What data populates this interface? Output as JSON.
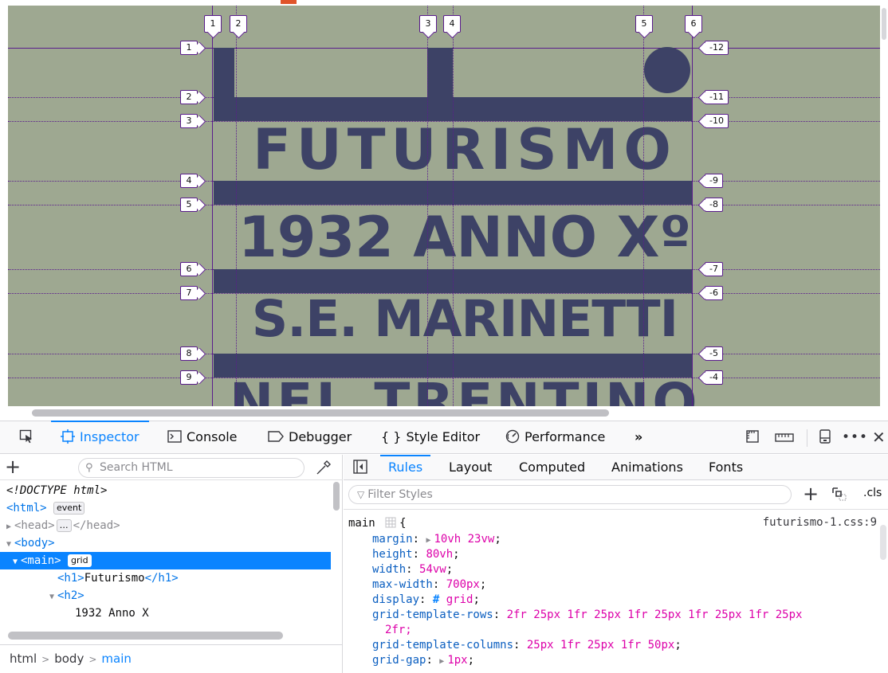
{
  "poster": {
    "lines": [
      "FUTURISMO",
      "1932 ANNO Xº",
      "S.E. MARINETTI",
      "NEL TRENTINO"
    ],
    "row_labels_left": [
      "1",
      "2",
      "3",
      "4",
      "5",
      "6",
      "7",
      "8",
      "9"
    ],
    "row_labels_right": [
      "-12",
      "-11",
      "-10",
      "-9",
      "-8",
      "-7",
      "-6",
      "-5",
      "-4"
    ],
    "col_labels_top": [
      "1",
      "2",
      "3",
      "4",
      "5",
      "6"
    ],
    "colors": {
      "background": "#9ea891",
      "ink": "#3d4266",
      "grid_overlay": "#5a1d8c"
    }
  },
  "devtools": {
    "tabs": [
      {
        "label": "Inspector",
        "icon": "inspector-icon"
      },
      {
        "label": "Console",
        "icon": "console-icon"
      },
      {
        "label": "Debugger",
        "icon": "debugger-icon"
      },
      {
        "label": "Style Editor",
        "icon": "style-editor-icon"
      },
      {
        "label": "Performance",
        "icon": "performance-icon"
      }
    ],
    "overflow_label": "»",
    "markup": {
      "search_placeholder": "Search HTML",
      "lines": [
        {
          "text": "<!DOCTYPE html>"
        },
        {
          "tag": "<html>",
          "badge": "event"
        },
        {
          "tag_open": "<head>",
          "badge": "…",
          "tag_close": "</head>"
        },
        {
          "tag": "<body>"
        },
        {
          "tag": "<main>",
          "badge": "grid",
          "selected": true
        },
        {
          "tag_open": "<h1>",
          "text": "Futurismo",
          "tag_close": "</h1>"
        },
        {
          "tag": "<h2>"
        },
        {
          "text": "1932 Anno X"
        }
      ],
      "breadcrumbs": [
        "html",
        "body",
        "main"
      ]
    },
    "rules": {
      "tabs": [
        "Rules",
        "Layout",
        "Computed",
        "Animations",
        "Fonts"
      ],
      "filter_placeholder": "Filter Styles",
      "cls_label": ".cls",
      "selector": "main",
      "source": "futurismo-1.css:9",
      "declarations": [
        {
          "prop": "margin",
          "val": "10vh 23vw",
          "expander": true
        },
        {
          "prop": "height",
          "val": "80vh"
        },
        {
          "prop": "width",
          "val": "54vw"
        },
        {
          "prop": "max-width",
          "val": "700px"
        },
        {
          "prop": "display",
          "val": "grid",
          "grid_icon": true
        },
        {
          "prop": "grid-template-rows",
          "val": "2fr 25px 1fr 25px 1fr 25px 1fr 25px 1fr 25px",
          "val_cont": "2fr;"
        },
        {
          "prop": "grid-template-columns",
          "val": "25px 1fr 25px 1fr 50px"
        },
        {
          "prop": "grid-gap",
          "val": "1px",
          "expander": true
        }
      ]
    }
  }
}
